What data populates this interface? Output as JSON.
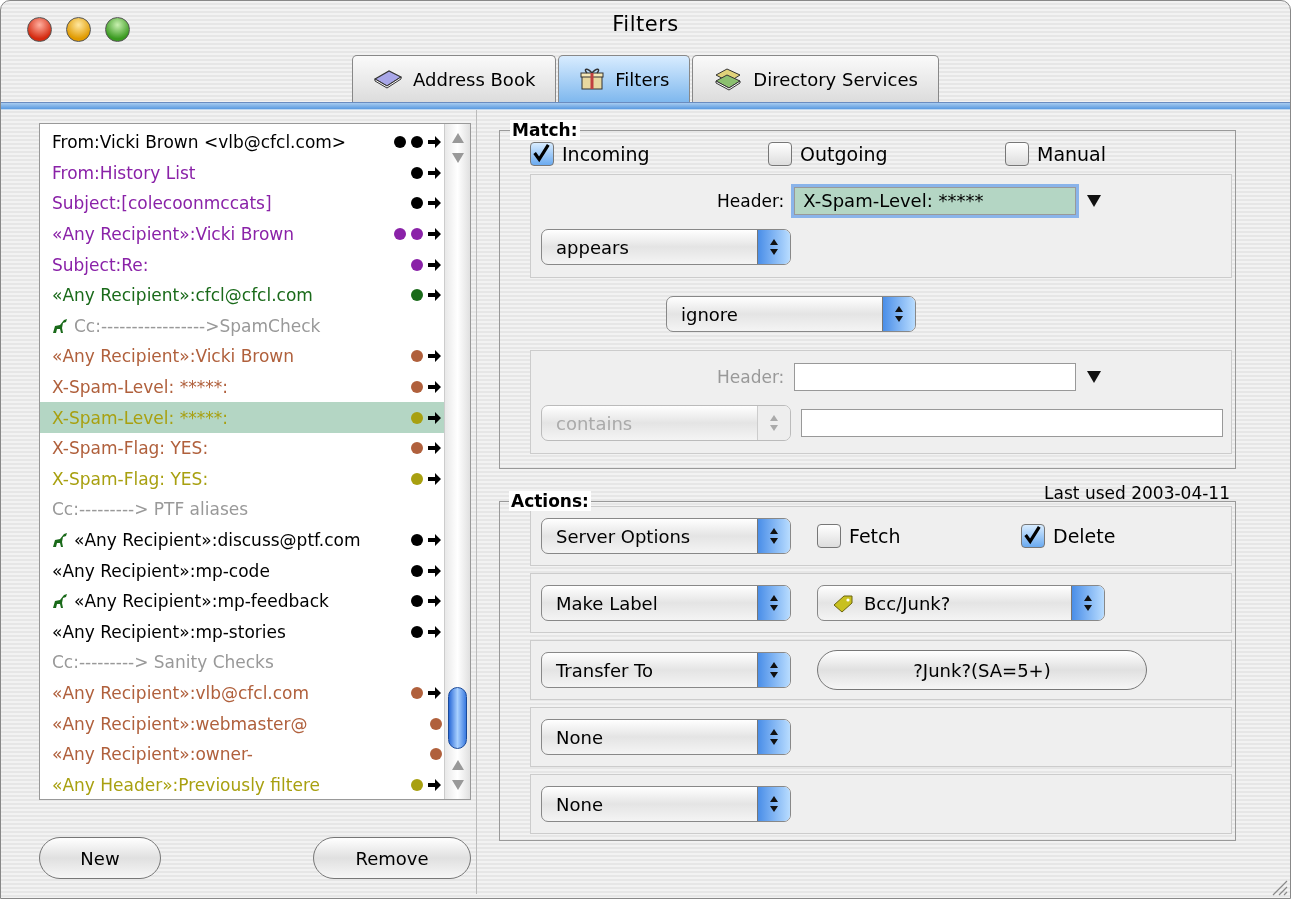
{
  "window": {
    "title": "Filters"
  },
  "tabs": [
    {
      "label": "Address Book",
      "selected": false,
      "kind": "book"
    },
    {
      "label": "Filters",
      "selected": true,
      "kind": "gift"
    },
    {
      "label": "Directory Services",
      "selected": false,
      "kind": "books"
    }
  ],
  "filters": [
    {
      "text": "From:Vicki Brown <vlb@cfcl.com>",
      "color": "#000000",
      "dots": [
        {
          "color": "#000000"
        },
        {
          "color": "#000000"
        }
      ],
      "arrow": true,
      "flagged": false,
      "selected": false
    },
    {
      "text": "From:History List",
      "color": "#8a22a8",
      "dots": [
        {
          "color": "#000000"
        }
      ],
      "arrow": true,
      "flagged": false,
      "selected": false
    },
    {
      "text": "Subject:[colecoonmccats]",
      "color": "#8a22a8",
      "dots": [
        {
          "color": "#000000"
        }
      ],
      "arrow": true,
      "flagged": false,
      "selected": false
    },
    {
      "text": "«Any Recipient»:Vicki Brown",
      "color": "#8a22a8",
      "dots": [
        {
          "color": "#8a22a8"
        },
        {
          "color": "#8a22a8"
        }
      ],
      "arrow": true,
      "flagged": false,
      "selected": false
    },
    {
      "text": "Subject:Re:",
      "color": "#8a22a8",
      "dots": [
        {
          "color": "#8a22a8"
        }
      ],
      "arrow": true,
      "flagged": false,
      "selected": false
    },
    {
      "text": "«Any Recipient»:cfcl@cfcl.com",
      "color": "#1a6a1a",
      "dots": [
        {
          "color": "#1a6a1a"
        }
      ],
      "arrow": true,
      "flagged": false,
      "selected": false
    },
    {
      "text": "Cc:----------------->SpamCheck",
      "color": "#999999",
      "arrow": false,
      "flagged": true,
      "selected": false
    },
    {
      "text": "«Any Recipient»:Vicki Brown",
      "color": "#b0603c",
      "dots": [
        {
          "color": "#b0603c"
        }
      ],
      "arrow": true,
      "flagged": false,
      "selected": false
    },
    {
      "text": "X-Spam-Level: *****:",
      "color": "#b0603c",
      "dots": [
        {
          "color": "#b0603c"
        }
      ],
      "arrow": true,
      "flagged": false,
      "selected": false
    },
    {
      "text": "X-Spam-Level: *****:",
      "color": "#a8a010",
      "dots": [
        {
          "color": "#a8a010"
        }
      ],
      "arrow": true,
      "flagged": false,
      "selected": true
    },
    {
      "text": "X-Spam-Flag: YES:",
      "color": "#b0603c",
      "dots": [
        {
          "color": "#b0603c"
        }
      ],
      "arrow": true,
      "flagged": false,
      "selected": false
    },
    {
      "text": "X-Spam-Flag: YES:",
      "color": "#a8a010",
      "dots": [
        {
          "color": "#a8a010"
        }
      ],
      "arrow": true,
      "flagged": false,
      "selected": false
    },
    {
      "text": "Cc:--------->   PTF aliases",
      "color": "#999999",
      "arrow": false,
      "flagged": false,
      "selected": false
    },
    {
      "text": "«Any Recipient»:discuss@ptf.com",
      "color": "#000000",
      "dots": [
        {
          "color": "#000000"
        }
      ],
      "arrow": true,
      "flagged": true,
      "selected": false
    },
    {
      "text": "«Any Recipient»:mp-code",
      "color": "#000000",
      "dots": [
        {
          "color": "#000000"
        }
      ],
      "arrow": true,
      "flagged": false,
      "selected": false
    },
    {
      "text": "«Any Recipient»:mp-feedback",
      "color": "#000000",
      "dots": [
        {
          "color": "#000000"
        }
      ],
      "arrow": true,
      "flagged": true,
      "selected": false
    },
    {
      "text": "«Any Recipient»:mp-stories",
      "color": "#000000",
      "dots": [
        {
          "color": "#000000"
        }
      ],
      "arrow": true,
      "flagged": false,
      "selected": false
    },
    {
      "text": "Cc:---------> Sanity Checks",
      "color": "#999999",
      "arrow": false,
      "flagged": false,
      "selected": false
    },
    {
      "text": "«Any Recipient»:vlb@cfcl.com",
      "color": "#b0603c",
      "dots": [
        {
          "color": "#b0603c"
        }
      ],
      "arrow": true,
      "flagged": false,
      "selected": false
    },
    {
      "text": "«Any Recipient»:webmaster@",
      "color": "#b0603c",
      "dots": [
        {
          "color": "#b0603c"
        }
      ],
      "arrow": false,
      "flagged": false,
      "selected": false
    },
    {
      "text": "«Any Recipient»:owner-",
      "color": "#b0603c",
      "dots": [
        {
          "color": "#b0603c"
        }
      ],
      "arrow": false,
      "flagged": false,
      "selected": false
    },
    {
      "text": "«Any Header»:Previously filtere",
      "color": "#a8a010",
      "dots": [
        {
          "color": "#a8a010"
        }
      ],
      "arrow": true,
      "flagged": false,
      "selected": false
    }
  ],
  "buttons": [
    "New",
    "Remove"
  ],
  "match": {
    "title": "Match:",
    "options": [
      {
        "label": "Incoming",
        "checked": true
      },
      {
        "label": "Outgoing",
        "checked": false
      },
      {
        "label": "Manual",
        "checked": false
      }
    ],
    "first": {
      "label": "Header:",
      "value": "X-Spam-Level: *****",
      "operator": "appears",
      "disabled": false
    },
    "conjunction": "ignore",
    "second": {
      "label": "Header:",
      "operator": "contains",
      "disabled": true
    }
  },
  "actions": {
    "title": "Actions:",
    "last_used": "Last used 2003-04-11",
    "rows": [
      {
        "kind": "options",
        "action": "Server Options",
        "options": [
          {
            "label": "Fetch",
            "checked": false
          },
          {
            "label": "Delete",
            "checked": true
          }
        ]
      },
      {
        "kind": "label",
        "action": "Make Label",
        "value": "Bcc/Junk?"
      },
      {
        "kind": "mailbox",
        "action": "Transfer To",
        "value": "?Junk?(SA=5+)"
      },
      {
        "kind": "none",
        "action": "None"
      },
      {
        "kind": "none",
        "action": "None"
      }
    ]
  }
}
